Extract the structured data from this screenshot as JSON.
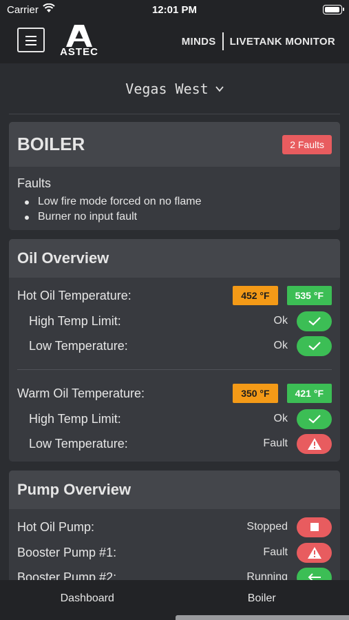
{
  "status_bar": {
    "carrier": "Carrier",
    "time": "12:01 PM"
  },
  "app_bar": {
    "logo_text": "ASTEC",
    "brand_left": "MINDS",
    "brand_right": "LIVETANK MONITOR"
  },
  "location": {
    "name": "Vegas West"
  },
  "boiler_card": {
    "title": "BOILER",
    "faults_badge": "2 Faults",
    "faults_label": "Faults",
    "faults": [
      "Low fire mode forced on no flame",
      "Burner no input fault"
    ]
  },
  "oil_overview": {
    "title": "Oil Overview",
    "hot_oil": {
      "label": "Hot Oil Temperature:",
      "current": "452 °F",
      "setpoint": "535 °F",
      "high_temp": {
        "label": "High Temp Limit:",
        "status": "Ok"
      },
      "low_temp": {
        "label": "Low Temperature:",
        "status": "Ok"
      }
    },
    "warm_oil": {
      "label": "Warm Oil Temperature:",
      "current": "350 °F",
      "setpoint": "421 °F",
      "high_temp": {
        "label": "High Temp Limit:",
        "status": "Ok"
      },
      "low_temp": {
        "label": "Low Temperature:",
        "status": "Fault"
      }
    }
  },
  "pump_overview": {
    "title": "Pump Overview",
    "pumps": [
      {
        "label": "Hot Oil Pump:",
        "status": "Stopped",
        "icon": "stop-icon"
      },
      {
        "label": "Booster Pump #1:",
        "status": "Fault",
        "icon": "warning-icon"
      },
      {
        "label": "Booster Pump #2:",
        "status": "Running",
        "icon": "arrow-left-icon"
      }
    ]
  },
  "bottom_nav": {
    "tabs": [
      "Dashboard",
      "Boiler"
    ]
  },
  "colors": {
    "ok": "#3cbe55",
    "fault": "#e85c5f",
    "temp_current": "#f49a17",
    "card": "#383a3f",
    "card_header": "#44464b"
  }
}
